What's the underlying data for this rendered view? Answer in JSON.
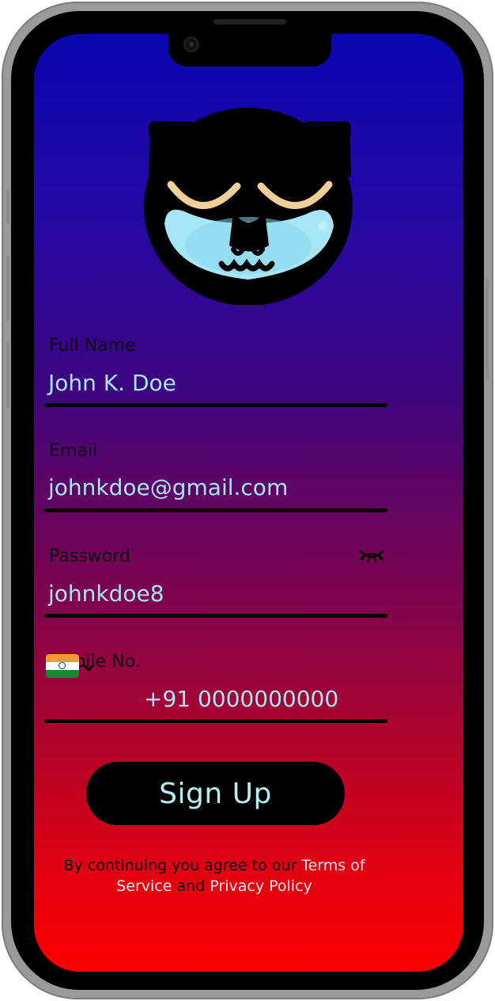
{
  "form": {
    "full_name": {
      "label": "Full Name",
      "value": "John K. Doe"
    },
    "email": {
      "label": "Email",
      "value": "johnkdoe@gmail.com"
    },
    "password": {
      "label": "Password",
      "value": "johnkdoe8",
      "toggle_icon": "eye-closed-icon"
    },
    "mobile": {
      "label": "Mobile No.",
      "country_flag": "india-flag-icon",
      "value": "+91 0000000000"
    }
  },
  "signup_button": {
    "label": "Sign Up"
  },
  "terms": {
    "prefix": "By continuing you agree to our ",
    "terms_link": "Terms of Service",
    "conjunction": " and ",
    "privacy_link": "Privacy Policy"
  },
  "colors": {
    "gradient_top": "#0a06b0",
    "gradient_bottom": "#fb0000",
    "value_text": "#a8e4f2",
    "button_bg": "#000000",
    "button_text": "#b6eef6"
  }
}
